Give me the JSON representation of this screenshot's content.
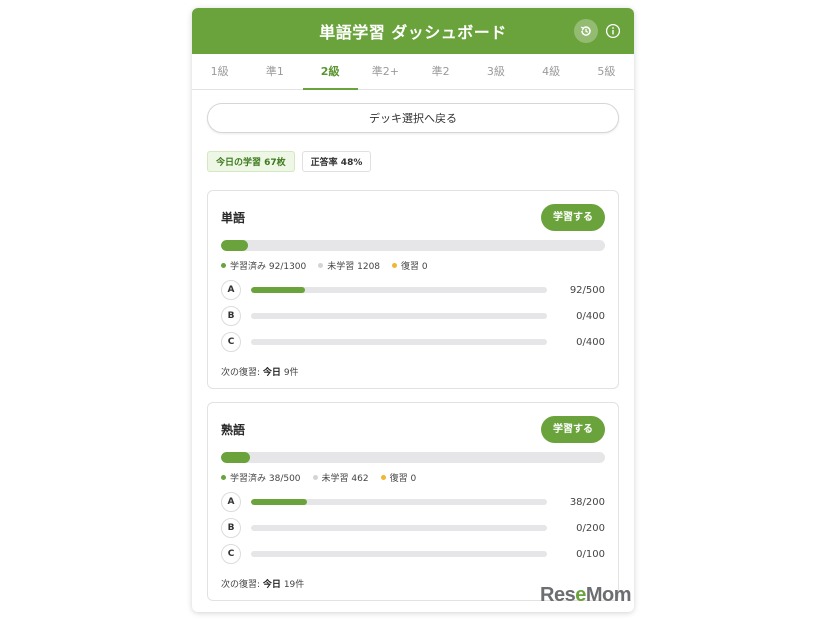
{
  "header": {
    "title": "単語学習 ダッシュボード"
  },
  "tabs": [
    {
      "label": "1級"
    },
    {
      "label": "準1"
    },
    {
      "label": "2級",
      "active": true
    },
    {
      "label": "準2+"
    },
    {
      "label": "準2"
    },
    {
      "label": "3級"
    },
    {
      "label": "4級"
    },
    {
      "label": "5級"
    }
  ],
  "back_button": {
    "label": "デッキ選択へ戻る"
  },
  "stats": {
    "today": "今日の学習 67枚",
    "accuracy": "正答率 48%"
  },
  "cards": [
    {
      "title": "単語",
      "study_label": "学習する",
      "progress": 0.0708,
      "legend": {
        "learned": "学習済み 92/1300",
        "unlearned": "未学習 1208",
        "review": "復習 0"
      },
      "levels": [
        {
          "badge": "A",
          "count": "92/500",
          "progress": 0.184
        },
        {
          "badge": "B",
          "count": "0/400",
          "progress": 0
        },
        {
          "badge": "C",
          "count": "0/400",
          "progress": 0
        }
      ],
      "next_label": "次の復習:",
      "next_day": "今日",
      "next_count": "9件"
    },
    {
      "title": "熟語",
      "study_label": "学習する",
      "progress": 0.076,
      "legend": {
        "learned": "学習済み 38/500",
        "unlearned": "未学習 462",
        "review": "復習 0"
      },
      "levels": [
        {
          "badge": "A",
          "count": "38/200",
          "progress": 0.19
        },
        {
          "badge": "B",
          "count": "0/200",
          "progress": 0
        },
        {
          "badge": "C",
          "count": "0/100",
          "progress": 0
        }
      ],
      "next_label": "次の復習:",
      "next_day": "今日",
      "next_count": "19件"
    }
  ],
  "watermark": {
    "brand_r": "Res",
    "brand_e": "e",
    "brand_rest": "Mom"
  },
  "colors": {
    "accent": "#6aa33c",
    "review": "#f2b632",
    "track": "#e6e6e8"
  }
}
